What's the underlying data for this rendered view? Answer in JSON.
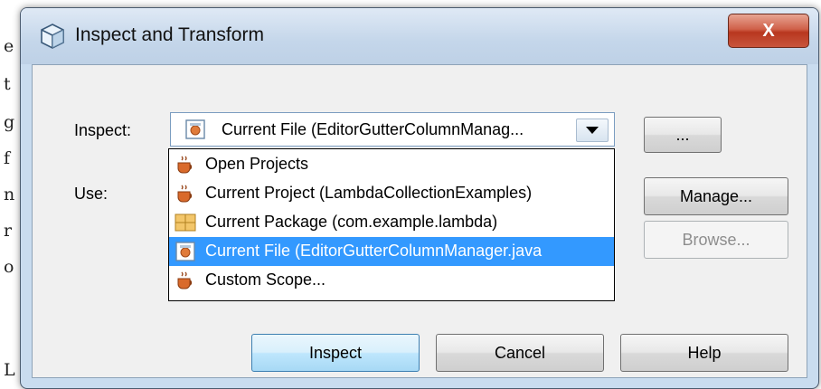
{
  "background_editor": {
    "line_fragments": [
      "e",
      "t",
      "g",
      "f",
      "n",
      "r",
      "o",
      "L"
    ]
  },
  "dialog": {
    "title": "Inspect and Transform",
    "close_label": "X",
    "inspect_label": "Inspect:",
    "use_label": "Use:",
    "scope_combo": {
      "selected_value": "Current File (EditorGutterColumnManag..."
    },
    "browse_dots_label": "...",
    "manage_label": "Manage...",
    "browse_label": "Browse...",
    "scope_options": [
      {
        "label": "Open Projects",
        "icon": "java-cup-icon",
        "selected": false
      },
      {
        "label": "Current Project (LambdaCollectionExamples)",
        "icon": "java-cup-icon",
        "selected": false
      },
      {
        "label": "Current Package (com.example.lambda)",
        "icon": "package-icon",
        "selected": false
      },
      {
        "label": "Current File (EditorGutterColumnManager.java",
        "icon": "java-file-icon",
        "selected": true
      },
      {
        "label": "Custom Scope...",
        "icon": "java-cup-icon",
        "selected": false
      }
    ],
    "buttons": {
      "inspect": "Inspect",
      "cancel": "Cancel",
      "help": "Help"
    }
  },
  "colors": {
    "selection": "#3399ff",
    "window_frame": "#c9dcef",
    "close_button": "#c8553d"
  }
}
